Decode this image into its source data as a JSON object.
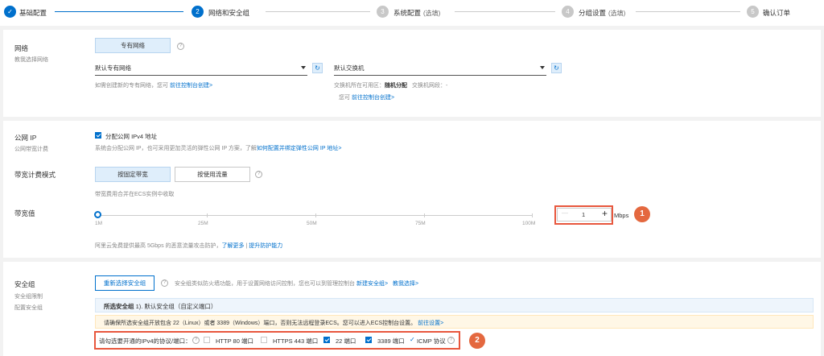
{
  "steps": [
    {
      "num": "✓",
      "label": "基础配置",
      "state": "done"
    },
    {
      "num": "2",
      "label": "网络和安全组",
      "state": "active"
    },
    {
      "num": "3",
      "label": "系统配置",
      "optional": "(选填)",
      "state": "todo"
    },
    {
      "num": "4",
      "label": "分组设置",
      "optional": "(选填)",
      "state": "todo"
    },
    {
      "num": "5",
      "label": "确认订单",
      "state": "todo"
    }
  ],
  "network": {
    "title": "网络",
    "subtitle": "教我选择网络",
    "vpc_button": "专有网络",
    "vpc_select": "默认专有网络",
    "vswitch_select": "默认交换机",
    "vpc_hint": "如需创建新的专有网络，您可",
    "vpc_hint_link": "前往控制台创建>",
    "vswitch_hint_zone_label": "交换机所在可用区：",
    "vswitch_hint_zone_value": "随机分配",
    "vswitch_hint_cidr_label": "交换机网段：",
    "vswitch_hint_cidr_value": "-",
    "vswitch_hint2": "您可",
    "vswitch_hint2_link": "前往控制台创建>"
  },
  "public_ip": {
    "title": "公网 IP",
    "subtitle": "公网带宽计费",
    "checkbox_label": "分配公网 IPv4 地址",
    "checked": true,
    "desc": "系统会分配公网 IP，也可采用更加灵活的弹性公网 IP 方案，了解",
    "desc_link": "如何配置并绑定弹性公网 IP 地址>"
  },
  "billing": {
    "title": "带宽计费模式",
    "options": [
      "按固定带宽",
      "按使用流量"
    ],
    "selected": "按固定带宽",
    "hint": "带宽费用合并在ECS实例中收取"
  },
  "bandwidth": {
    "title": "带宽值",
    "ticks": [
      "1M",
      "25M",
      "50M",
      "75M",
      "100M"
    ],
    "value": "1",
    "unit": "Mbps",
    "minus": "—",
    "plus": "+",
    "note": "阿里云免费提供最高 5Gbps 的恶意流量攻击防护，",
    "note_link1": "了解更多",
    "note_sep": "|",
    "note_link2": "提升防护能力"
  },
  "security": {
    "title": "安全组",
    "sub1": "安全组限制",
    "sub2": "配置安全组",
    "reselect_button": "重新选择安全组",
    "desc": "安全组类似防火墙功能，用于设置网络访问控制，您也可以到管理控制台",
    "desc_link1": "新建安全组>",
    "desc_link2": "教我选择>",
    "selected_label": "所选安全组",
    "selected_value": "1). 默认安全组（自定义端口）",
    "warning": "请确保所选安全组开放包含 22（Linux）或者 3389（Windows）端口，否则无法远程登录ECS。您可以进入ECS控制台设置。",
    "warning_link": "前往设置>",
    "ports_label": "请勾选要开通的IPv4的协议/端口：",
    "ports": [
      {
        "label": "HTTP 80 端口",
        "checked": false
      },
      {
        "label": "HTTPS 443 端口",
        "checked": false
      },
      {
        "label": "22 端口",
        "checked": true
      },
      {
        "label": "3389 端口",
        "checked": true
      }
    ],
    "icmp": "ICMP 协议"
  },
  "callouts": [
    "1",
    "2"
  ],
  "colors": {
    "accent": "#0070cc",
    "callout": "#e4683f",
    "highlight": "#e8573d"
  }
}
